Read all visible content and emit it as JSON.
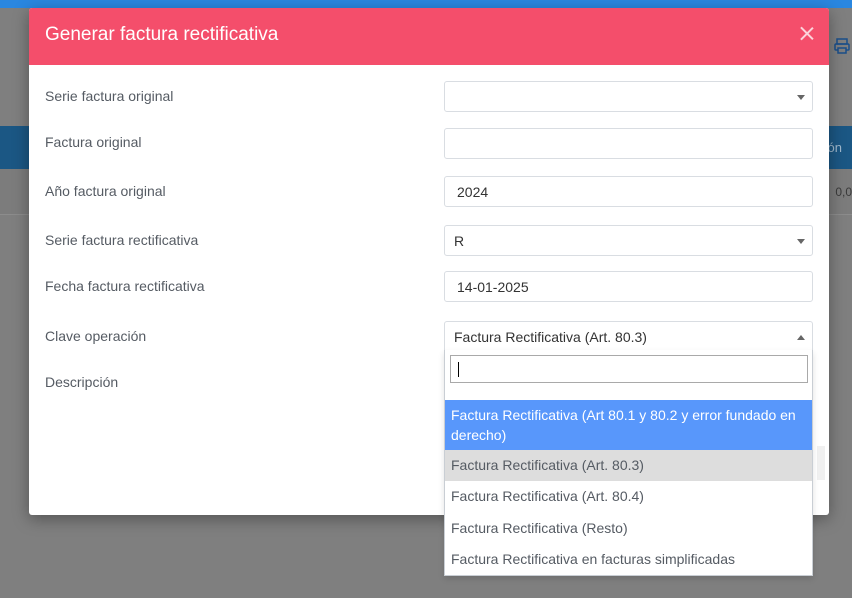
{
  "background": {
    "nav_text": "ción",
    "row_text": "0,0"
  },
  "modal": {
    "title": "Generar factura rectificativa",
    "fields": {
      "serie_original": {
        "label": "Serie factura original",
        "value": ""
      },
      "factura_original": {
        "label": "Factura original",
        "value": ""
      },
      "anio_original": {
        "label": "Año factura original",
        "value": "2024"
      },
      "serie_rectificativa": {
        "label": "Serie factura rectificativa",
        "value": "R"
      },
      "fecha_rectificativa": {
        "label": "Fecha factura rectificativa",
        "value": "14-01-2025"
      },
      "clave_operacion": {
        "label": "Clave operación",
        "value": "Factura Rectificativa (Art. 80.3)"
      },
      "descripcion": {
        "label": "Descripción"
      }
    }
  },
  "dropdown": {
    "search_value": "",
    "options": [
      "Factura Rectificativa (Art 80.1 y 80.2 y error fundado en derecho)",
      "Factura Rectificativa (Art. 80.3)",
      "Factura Rectificativa (Art. 80.4)",
      "Factura Rectificativa (Resto)",
      "Factura Rectificativa en facturas simplificadas"
    ],
    "highlighted_index": 0,
    "selected_index": 1
  },
  "colors": {
    "header": "#f44e6b",
    "highlight": "#5897fb",
    "selected": "#dddddd",
    "topbar": "#2a87e0"
  }
}
